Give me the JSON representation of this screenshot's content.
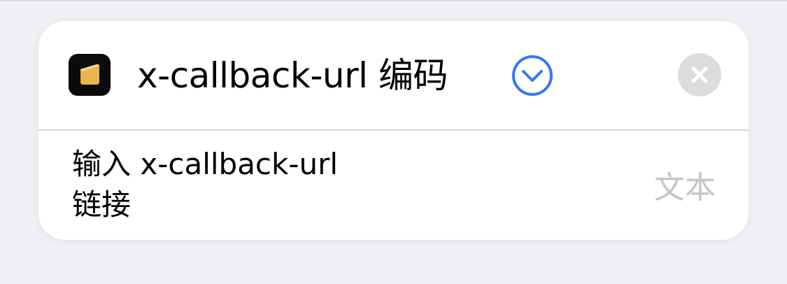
{
  "action": {
    "title": "x-callback-url 编码",
    "app_icon": "notes-app-icon",
    "expand_icon": "chevron-down-circle-icon",
    "close_icon": "close-x-icon",
    "accent_color": "#3478f6"
  },
  "parameter": {
    "label_line1": "输入 x-callback-url",
    "label_line2": "链接",
    "value": "文本"
  }
}
